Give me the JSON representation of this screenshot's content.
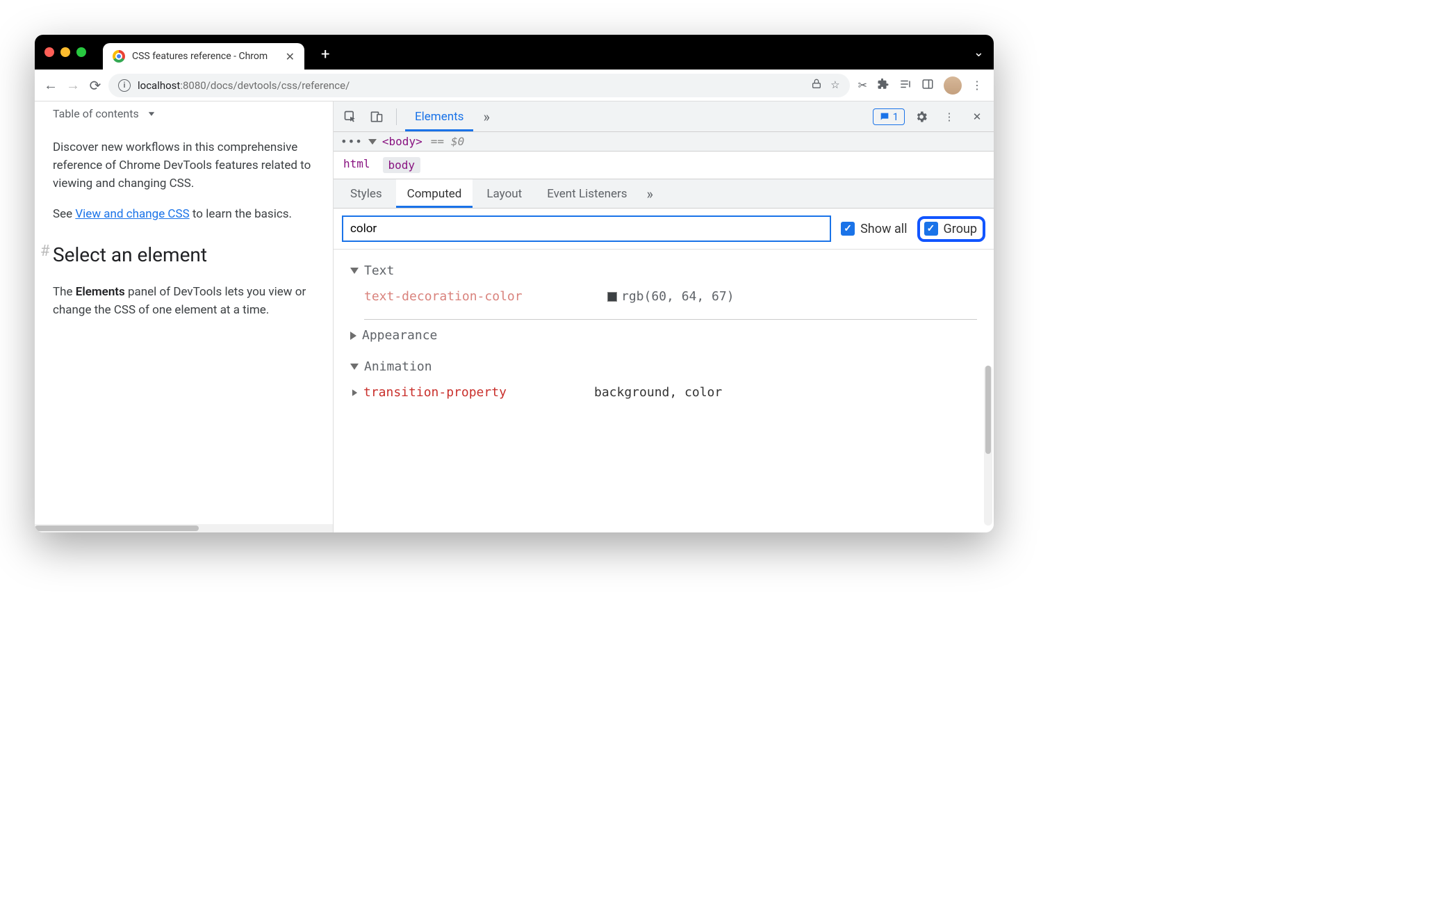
{
  "tab": {
    "title": "CSS features reference - Chrom"
  },
  "url": {
    "host": "localhost",
    "port": ":8080",
    "path": "/docs/devtools/css/reference/"
  },
  "page": {
    "toc": "Table of contents",
    "intro": "Discover new workflows in this comprehensive reference of Chrome DevTools features related to viewing and changing CSS.",
    "see": "See ",
    "link": "View and change CSS",
    "see_tail": " to learn the basics.",
    "h2": "Select an element",
    "p2a": "The ",
    "p2b": "Elements",
    "p2c": " panel of DevTools lets you view or change the CSS of one element at a time."
  },
  "devtools": {
    "main_tabs": {
      "elements": "Elements"
    },
    "messages_count": "1",
    "dom": {
      "tag": "<body>",
      "eq": "==",
      "dollar": "$0"
    },
    "breadcrumb": {
      "html": "html",
      "body": "body"
    },
    "subpanel": {
      "styles": "Styles",
      "computed": "Computed",
      "layout": "Layout",
      "event": "Event Listeners"
    },
    "filter": {
      "value": "color",
      "showall": "Show all",
      "group": "Group"
    },
    "groups": {
      "text": {
        "label": "Text",
        "props": [
          {
            "name": "text-decoration-color",
            "value": "rgb(60, 64, 67)",
            "swatch": true,
            "muted": true
          }
        ]
      },
      "appearance": {
        "label": "Appearance"
      },
      "animation": {
        "label": "Animation",
        "props": [
          {
            "name": "transition-property",
            "value": "background, color"
          }
        ]
      }
    }
  }
}
